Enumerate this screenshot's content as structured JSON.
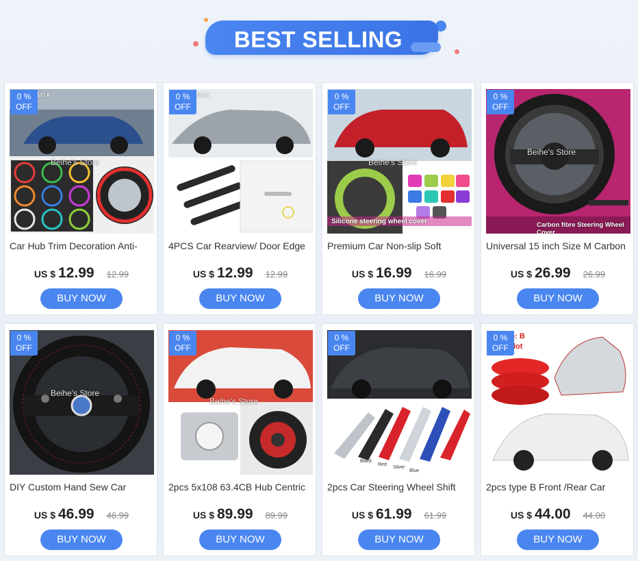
{
  "header": {
    "title": "BEST SELLING"
  },
  "colors": {
    "accent": "#4a86f0",
    "badge": "#4a86f0"
  },
  "products": [
    {
      "badge_line1": "0  %",
      "badge_line2": "OFF",
      "name": "Car Hub Trim Decoration Anti-",
      "currency": "US $",
      "price": "12.99",
      "old_price": "12.99",
      "buy_label": "BUY NOW",
      "image_watermark": "Beihe's Store",
      "image_brand": "MIA",
      "image_caption": ""
    },
    {
      "badge_line1": "0  %",
      "badge_line2": "OFF",
      "name": "4PCS Car Rearview/ Door Edge",
      "currency": "US $",
      "price": "12.99",
      "old_price": "12.99",
      "buy_label": "BUY NOW",
      "image_watermark": "",
      "image_brand": "MIA",
      "image_caption": ""
    },
    {
      "badge_line1": "0  %",
      "badge_line2": "OFF",
      "name": "Premium Car Non-slip Soft",
      "currency": "US $",
      "price": "16.99",
      "old_price": "16.99",
      "buy_label": "BUY NOW",
      "image_watermark": "Beihe's Store",
      "image_brand": "",
      "image_caption": "Silicone steering wheel cover"
    },
    {
      "badge_line1": "0  %",
      "badge_line2": "OFF",
      "name": "Universal 15 inch Size M Carbon",
      "currency": "US $",
      "price": "26.99",
      "old_price": "26.99",
      "buy_label": "BUY NOW",
      "image_watermark": "Beihe's Store",
      "image_brand": "",
      "image_caption": "Carbon fibre Steering Wheel Cover"
    },
    {
      "badge_line1": "0  %",
      "badge_line2": "OFF",
      "name": "DIY Custom Hand Sew Car",
      "currency": "US $",
      "price": "46.99",
      "old_price": "46.99",
      "buy_label": "BUY NOW",
      "image_watermark": "Beihe's Store",
      "image_brand": "",
      "image_caption": ""
    },
    {
      "badge_line1": "0  %",
      "badge_line2": "OFF",
      "name": "2pcs 5x108 63.4CB Hub Centric",
      "currency": "US $",
      "price": "89.99",
      "old_price": "89.99",
      "buy_label": "BUY NOW",
      "image_watermark": "Beihe's Store",
      "image_brand": "",
      "image_caption": ""
    },
    {
      "badge_line1": "0  %",
      "badge_line2": "OFF",
      "name": "2pcs Car Steering Wheel Shift",
      "currency": "US $",
      "price": "61.99",
      "old_price": "61.99",
      "buy_label": "BUY NOW",
      "image_watermark": "",
      "image_brand": "",
      "image_caption": "",
      "paddle_labels": [
        "Black",
        "Red",
        "Silver",
        "Blue"
      ]
    },
    {
      "badge_line1": "0  %",
      "badge_line2": "OFF",
      "name": "2pcs type B Front /Rear Car",
      "currency": "US $",
      "price": "44.00",
      "old_price": "44.00",
      "buy_label": "BUY NOW",
      "image_watermark": "",
      "image_brand": "",
      "image_caption": "",
      "image_tag": "e: B",
      "image_tag2": "lot"
    }
  ]
}
